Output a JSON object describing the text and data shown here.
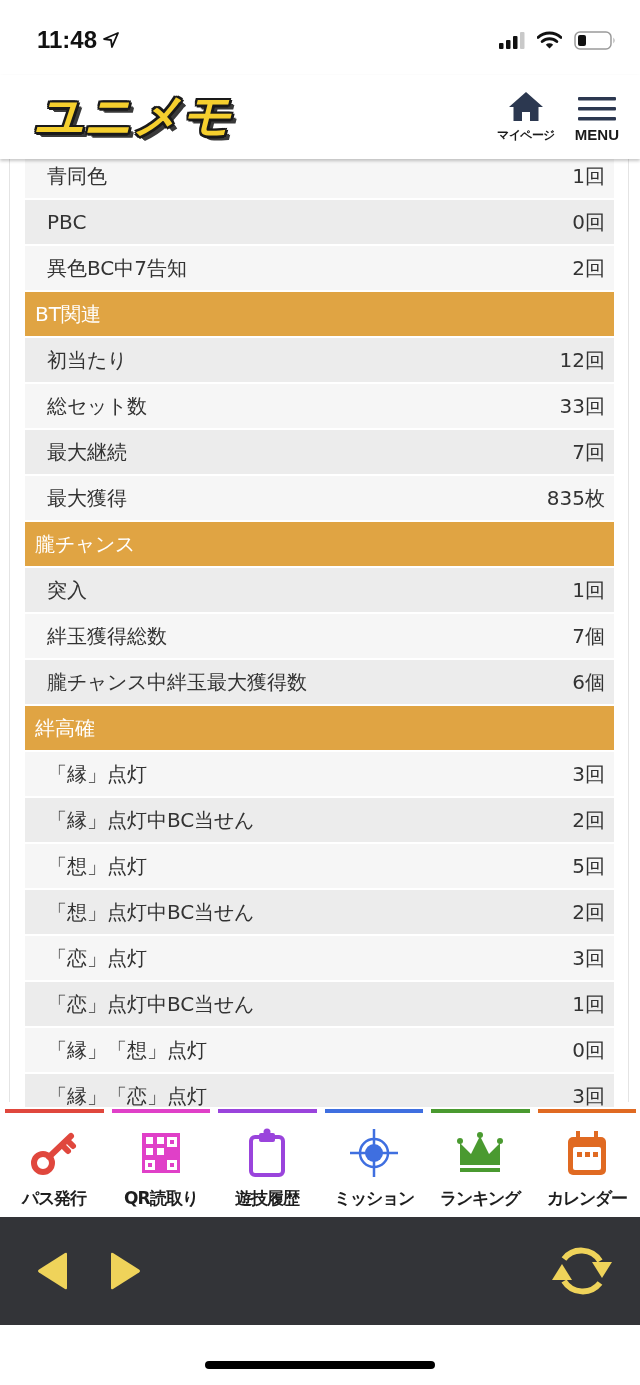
{
  "status_bar": {
    "time": "11:48"
  },
  "header": {
    "logo": "ユニメモ",
    "buttons": [
      {
        "label": "マイページ"
      },
      {
        "label": "MENU"
      }
    ]
  },
  "sections": [
    {
      "rows": [
        {
          "label": "青同色",
          "value": "1回"
        },
        {
          "label": "PBC",
          "value": "0回"
        },
        {
          "label": "異色BC中7告知",
          "value": "2回"
        }
      ]
    },
    {
      "title": "BT関連",
      "rows": [
        {
          "label": "初当たり",
          "value": "12回"
        },
        {
          "label": "総セット数",
          "value": "33回"
        },
        {
          "label": "最大継続",
          "value": "7回"
        },
        {
          "label": "最大獲得",
          "value": "835枚"
        }
      ]
    },
    {
      "title": "朧チャンス",
      "rows": [
        {
          "label": "突入",
          "value": "1回"
        },
        {
          "label": "絆玉獲得総数",
          "value": "7個"
        },
        {
          "label": "朧チャンス中絆玉最大獲得数",
          "value": "6個"
        }
      ]
    },
    {
      "title": "絆高確",
      "rows": [
        {
          "label": "「縁」点灯",
          "value": "3回"
        },
        {
          "label": "「縁」点灯中BC当せん",
          "value": "2回"
        },
        {
          "label": "「想」点灯",
          "value": "5回"
        },
        {
          "label": "「想」点灯中BC当せん",
          "value": "2回"
        },
        {
          "label": "「恋」点灯",
          "value": "3回"
        },
        {
          "label": "「恋」点灯中BC当せん",
          "value": "1回"
        },
        {
          "label": "「縁」「想」点灯",
          "value": "0回"
        },
        {
          "label": "「縁」「恋」点灯",
          "value": "3回"
        }
      ]
    }
  ],
  "bottom_nav": {
    "items": [
      {
        "label": "パス発行",
        "color": "#e0473d"
      },
      {
        "label": "QR読取り",
        "color": "#e040c8"
      },
      {
        "label": "遊技履歴",
        "color": "#9a44dc"
      },
      {
        "label": "ミッション",
        "color": "#3f6fe0"
      },
      {
        "label": "ランキング",
        "color": "#4a9a30"
      },
      {
        "label": "カレンダー",
        "color": "#e06a22"
      }
    ]
  }
}
